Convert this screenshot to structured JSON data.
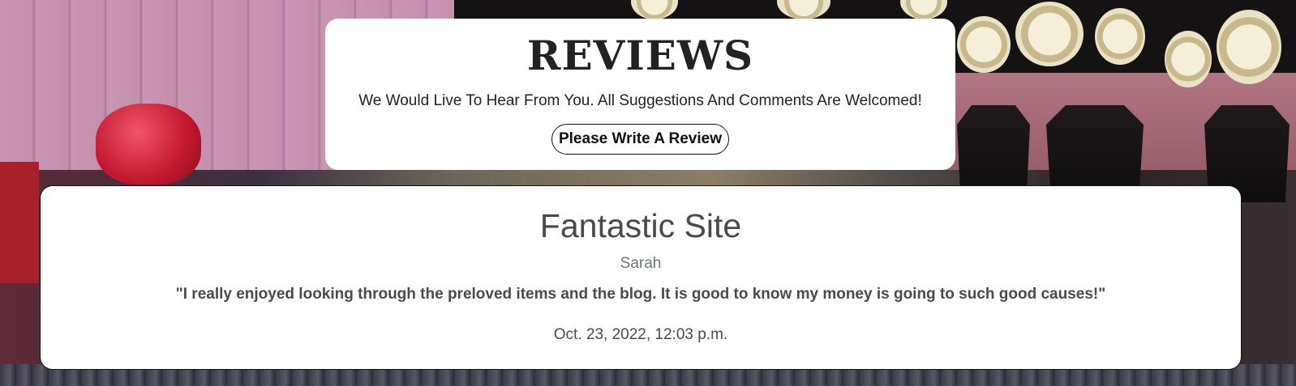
{
  "header": {
    "title": "REVIEWS",
    "subtitle": "We Would Live To Hear From You. All Suggestions And Comments Are Welcomed!",
    "write_review_label": "Please Write A Review"
  },
  "reviews": [
    {
      "title": "Fantastic Site",
      "author": "Sarah",
      "body": "\"I really enjoyed looking through the preloved items and the blog. It is good to know my money is going to such good causes!\"",
      "date": "Oct. 23, 2022, 12:03 p.m."
    }
  ],
  "colors": {
    "card_background": "#ffffff",
    "text_dark": "#222222",
    "text_body": "#4a4a4a",
    "text_muted": "#6c757d",
    "border": "#111111"
  }
}
